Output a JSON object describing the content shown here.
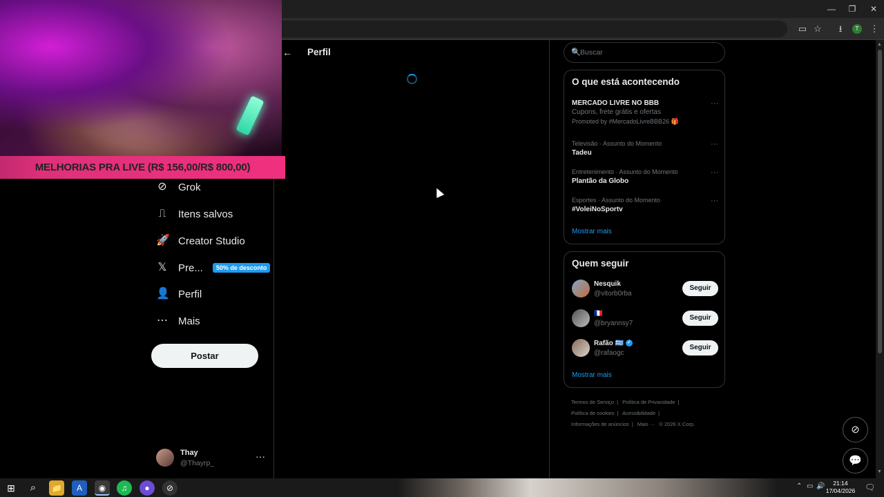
{
  "window": {
    "minimize": "—",
    "restore": "❐",
    "close": "✕"
  },
  "toolbar": {
    "cast": "▭",
    "star": "☆",
    "download": "⭳",
    "profile": "T",
    "menu": "⋮"
  },
  "stream_banner": "MELHORIAS PRA LIVE (R$ 156,00/R$ 800,00)",
  "nav": {
    "items": [
      {
        "label": "Grok",
        "icon": "grok-icon",
        "glyph": "⊘"
      },
      {
        "label": "Itens salvos",
        "icon": "bookmark-icon",
        "glyph": "⎍"
      },
      {
        "label": "Creator Studio",
        "icon": "rocket-icon",
        "glyph": "🚀"
      },
      {
        "label": "Pre...",
        "icon": "x-logo-icon",
        "glyph": "𝕏",
        "badge": "50% de desconto"
      },
      {
        "label": "Perfil",
        "icon": "person-icon",
        "glyph": "👤"
      },
      {
        "label": "Mais",
        "icon": "more-circle-icon",
        "glyph": "⋯"
      }
    ],
    "post_button": "Postar",
    "account": {
      "name": "Thay",
      "handle": "@Thayrp_",
      "more": "···"
    }
  },
  "main": {
    "back": "←",
    "title": "Perfil"
  },
  "search": {
    "placeholder": "Buscar",
    "icon": "🔍"
  },
  "trends": {
    "title": "O que está acontecendo",
    "items": [
      {
        "meta": "",
        "name": "MERCADO LIVRE NO BBB",
        "sub": "Cupons, frete grátis e ofertas",
        "promo": "Promoted by #MercadoLivreBBB26 🎁"
      },
      {
        "meta": "Televisão · Assunto do Momento",
        "name": "Tadeu"
      },
      {
        "meta": "Entretenimento · Assunto do Momento",
        "name": "Plantão da Globo"
      },
      {
        "meta": "Esportes · Assunto do Momento",
        "name": "#VoleiNoSportv"
      }
    ],
    "more_glyph": "···",
    "show_more": "Mostrar mais"
  },
  "who_to_follow": {
    "title": "Quem seguir",
    "items": [
      {
        "name": "Nesquik",
        "handle": "@vitorb0rba",
        "button": "Seguir"
      },
      {
        "name": "🇫🇷",
        "handle": "@bryannsy7",
        "button": "Seguir"
      },
      {
        "name": "Rafão 🇬🇷",
        "handle": "@rafaogc",
        "button": "Seguir",
        "verified": "✓"
      }
    ],
    "show_more": "Mostrar mais"
  },
  "footer": {
    "links": [
      "Termos de Serviço",
      "|",
      "Política de Privacidade",
      "|",
      "Política de cookies",
      "|",
      "Acessibilidade",
      "|",
      "Informações de anúncios",
      "|",
      "Mais ···",
      "© 2026 X Corp."
    ]
  },
  "float_buttons": {
    "grok": "⊘",
    "messages": "💬"
  },
  "taskbar": {
    "start": "⊞",
    "search": "⌕",
    "apps": [
      "📁",
      "A",
      "◉",
      "♫",
      "●",
      "⊘"
    ],
    "tray": {
      "chevron": "⌃",
      "battery": "▭",
      "volume": "🔊",
      "notification": "🗨"
    },
    "time": "21:14",
    "date": "17/04/2026"
  }
}
